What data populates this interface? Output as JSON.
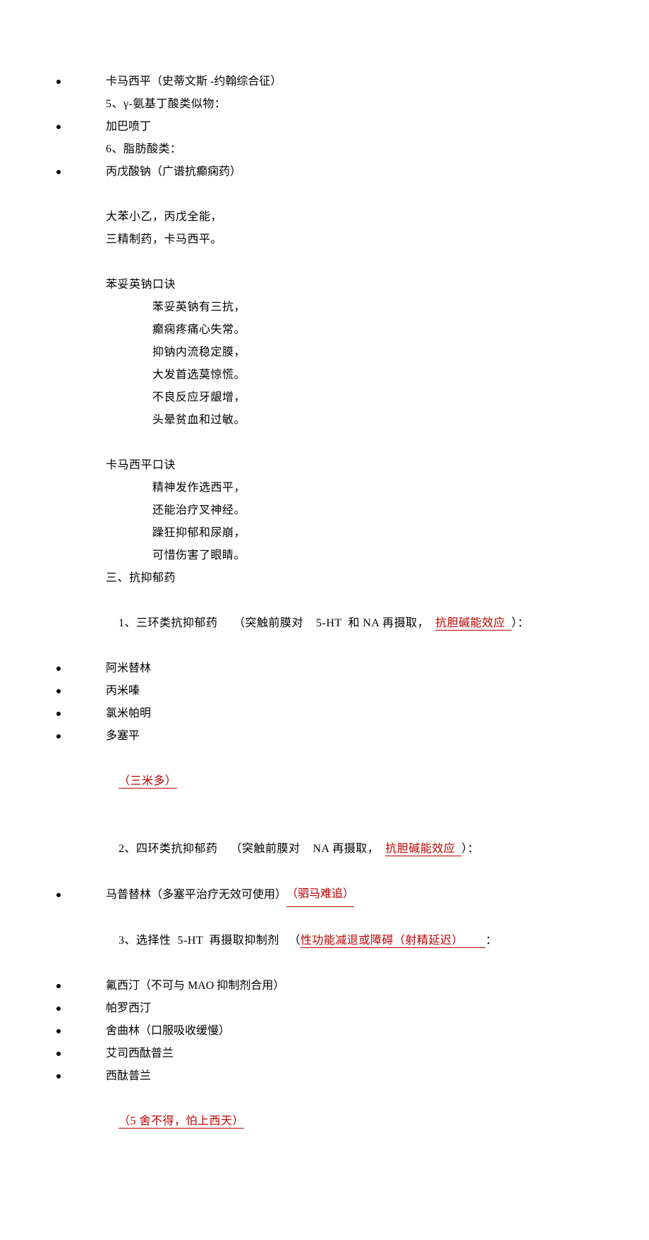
{
  "lines": {
    "b1": "卡马西平（史蒂文斯    -约翰综合征）",
    "l1": "5、γ-氨基丁酸类似物：",
    "b2": "加巴喷丁",
    "l2": "6、脂肪酸类：",
    "b3": "丙戊酸钠（广谱抗癫痫药）",
    "m1": "大苯小乙，丙戊全能，",
    "m2": "三精制药，卡马西平。",
    "m3": "苯妥英钠口诀",
    "m4": "苯妥英钠有三抗，",
    "m5": "癫痫疼痛心失常。",
    "m6": "抑钠内流稳定膜，",
    "m7": "大发首选莫惊慌。",
    "m8": "不良反应牙龈增，",
    "m9": "头晕贫血和过敏。",
    "m10": "卡马西平口诀",
    "m11": "精神发作选西平，",
    "m12": "还能治疗叉神经。",
    "m13": "躁狂抑郁和尿崩，",
    "m14": "可惜伤害了眼睛。",
    "m15": "三、抗抑郁药",
    "l3a": "1、三环类抗抑郁药     （突触前膜对    5-HT  和 NA 再摄取，  ",
    "l3u": "抗胆碱能效应  ",
    "l3b": "）：",
    "b4": "阿米替林",
    "b5": "丙米嗪",
    "b6": "氯米帕明",
    "b7": "多塞平",
    "u1": "（三米多）",
    "l4a": "2、四环类抗抑郁药    （突触前膜对    NA 再摄取，  ",
    "l4u": "抗胆碱能效应  ",
    "l4b": "）：",
    "b8a": "马普替林（多塞平治疗无效可使用）    ",
    "b8u": "（驷马难追）",
    "l5a": "3、选择性  5-HT  再摄取抑制剂   （",
    "l5u": "性功能减退或障碍（射精延迟）       ",
    "l5b": "：",
    "b9": "氟西汀（不可与    MAO 抑制剂合用）",
    "b10": "帕罗西汀",
    "b11": "舍曲林（口服吸收缓慢）",
    "b12": "艾司西酞普兰",
    "b13": "西酞普兰",
    "u2": "（5 舍不得，怕上西天）"
  }
}
